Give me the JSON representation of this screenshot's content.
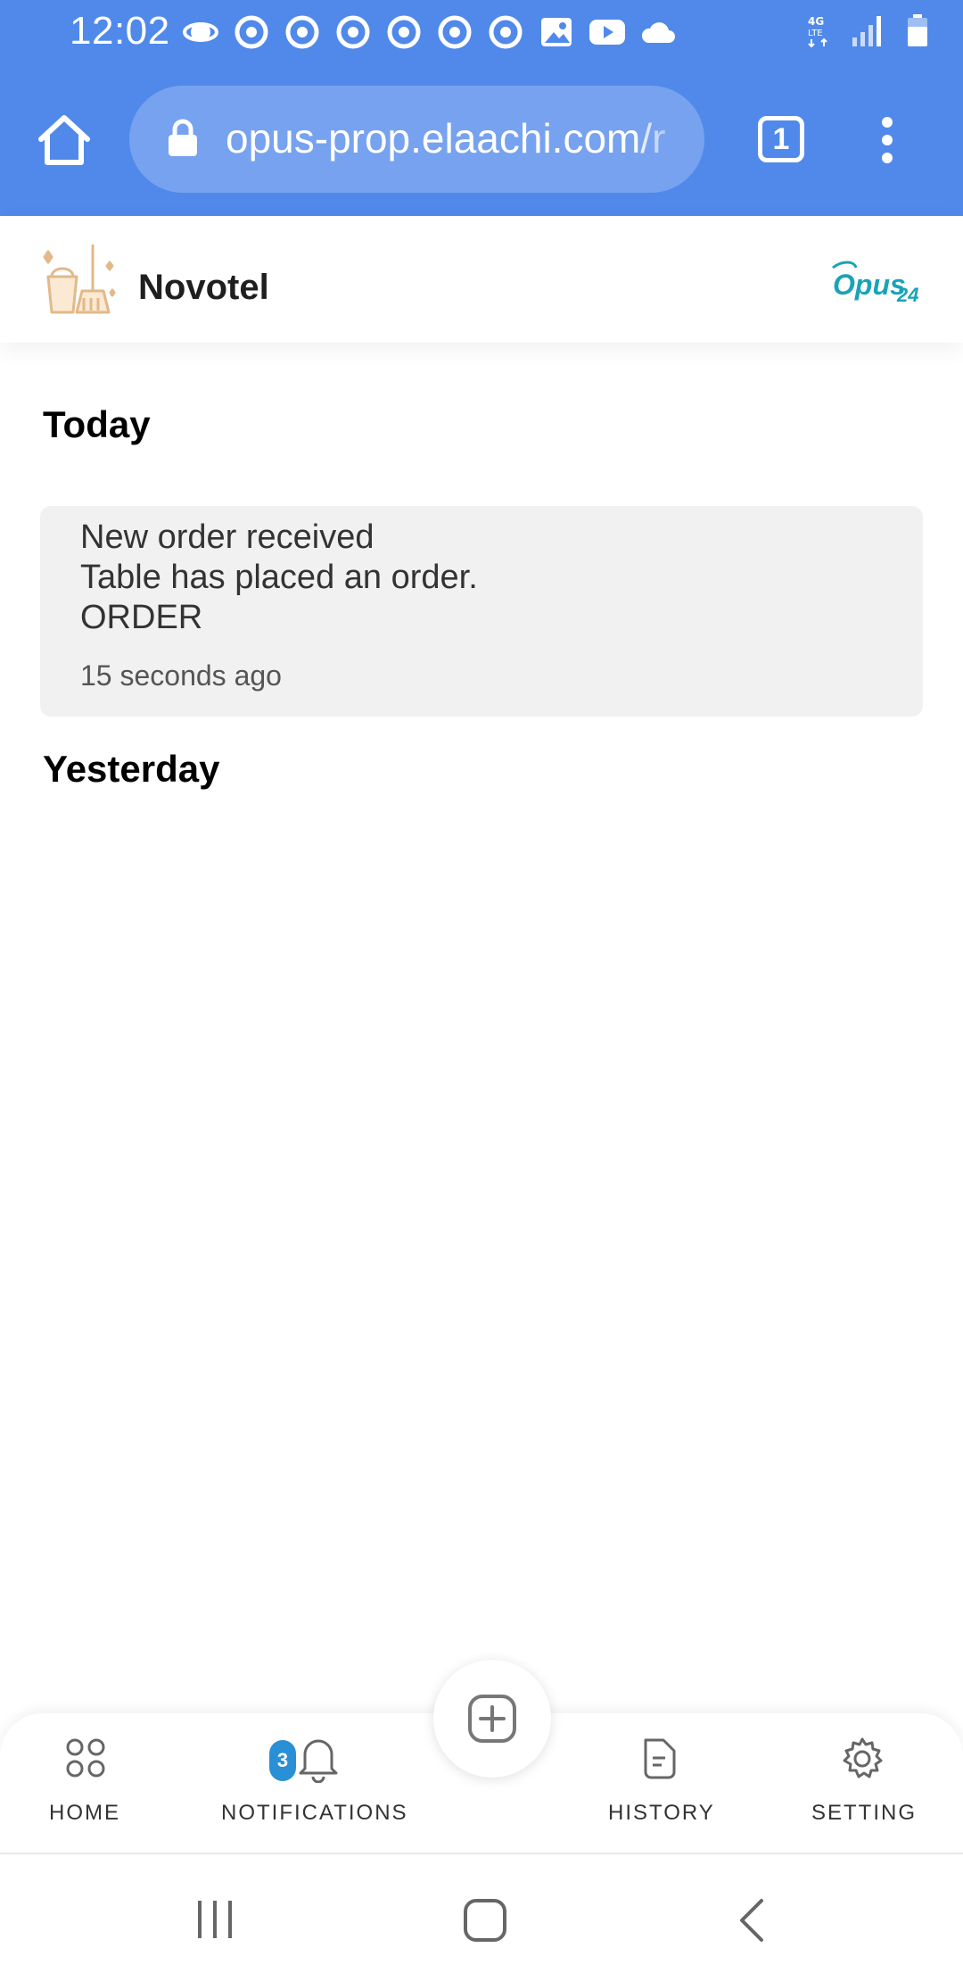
{
  "status_bar": {
    "time": "12:02",
    "icons": [
      "saturn-icon",
      "chrome-icon",
      "chrome-icon",
      "chrome-icon",
      "chrome-icon",
      "chrome-icon",
      "chrome-icon",
      "image-icon",
      "youtube-icon",
      "cloud-icon"
    ],
    "right_icons": [
      "4g-lte-icon",
      "signal-icon",
      "battery-icon"
    ]
  },
  "browser": {
    "url": "opus-prop.elaachi.com/r",
    "tab_count": "1"
  },
  "header": {
    "brand_name": "Novotel",
    "opus_logo": "Opus24"
  },
  "notifications": {
    "today_title": "Today",
    "yesterday_title": "Yesterday",
    "items": [
      {
        "title": "New order received",
        "message": "Table has placed an order.",
        "type": "ORDER",
        "time": "15 seconds ago"
      }
    ]
  },
  "bottom_nav": {
    "home": "HOME",
    "notifications": "NOTIFICATIONS",
    "notifications_badge": "3",
    "history": "HISTORY",
    "setting": "SETTING"
  },
  "colors": {
    "browser_bar": "#5089ea",
    "badge": "#2a90d6",
    "opus_teal": "#1aa3b8"
  }
}
